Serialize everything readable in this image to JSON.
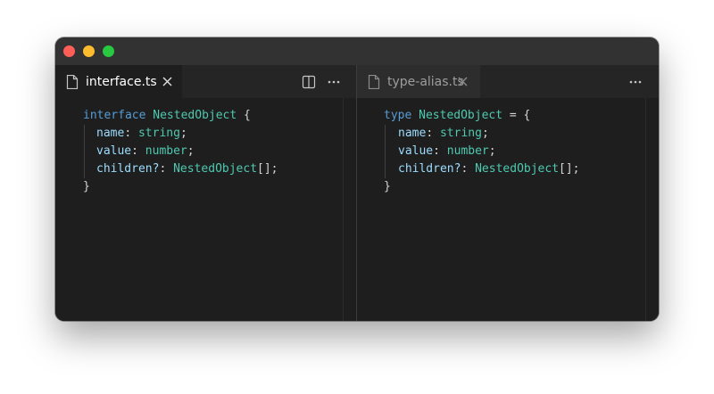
{
  "window": {
    "traffic_lights": [
      "close",
      "minimize",
      "zoom"
    ]
  },
  "left_pane": {
    "tab": {
      "label": "interface.ts",
      "icon": "file-icon",
      "close_icon": "close-icon"
    },
    "actions": [
      {
        "icon": "split-editor-icon"
      },
      {
        "icon": "more-actions-icon"
      }
    ],
    "code": {
      "line1": {
        "keyword": "interface",
        "type": "NestedObject",
        "punc": "{"
      },
      "line2": {
        "prop": "name",
        "colon": ":",
        "type": "string",
        "semi": ";"
      },
      "line3": {
        "prop": "value",
        "colon": ":",
        "type": "number",
        "semi": ";"
      },
      "line4": {
        "prop": "children?",
        "colon": ":",
        "type": "NestedObject",
        "tail": "[];"
      },
      "line5": {
        "punc": "}"
      }
    }
  },
  "right_pane": {
    "tab": {
      "label": "type-alias.ts",
      "icon": "file-icon",
      "close_icon": "close-icon"
    },
    "actions": [
      {
        "icon": "more-actions-icon"
      }
    ],
    "code": {
      "line1": {
        "keyword": "type",
        "type": "NestedObject",
        "punc": "= {"
      },
      "line2": {
        "prop": "name",
        "colon": ":",
        "type": "string",
        "semi": ";"
      },
      "line3": {
        "prop": "value",
        "colon": ":",
        "type": "number",
        "semi": ";"
      },
      "line4": {
        "prop": "children?",
        "colon": ":",
        "type": "NestedObject",
        "tail": "[];"
      },
      "line5": {
        "punc": "}"
      }
    }
  },
  "colors": {
    "keyword": "#569cd6",
    "type": "#4ec9b0",
    "property": "#9cdcfe",
    "punctuation": "#d4d4d4",
    "editor_bg": "#1e1e1e",
    "tabbar_bg": "#252526"
  }
}
